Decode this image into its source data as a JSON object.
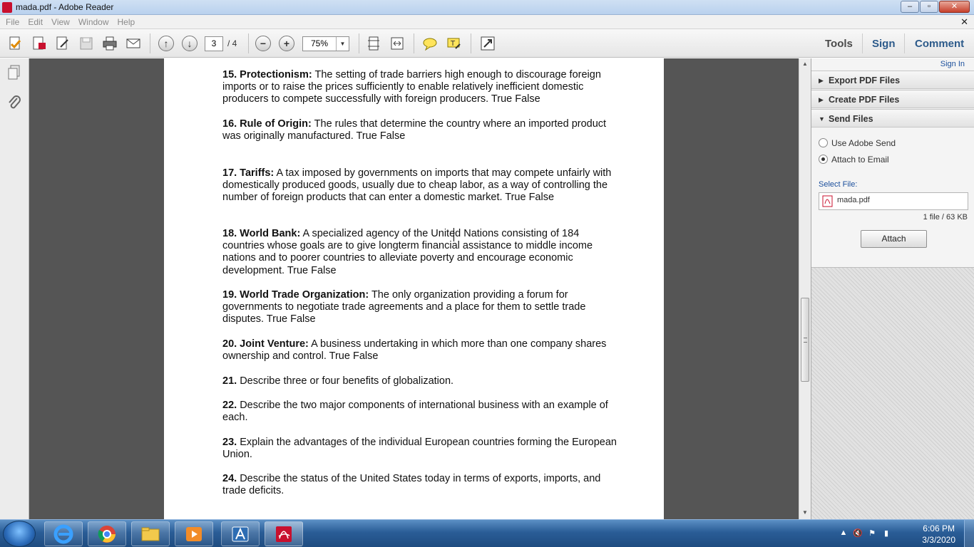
{
  "window": {
    "title": "mada.pdf - Adobe Reader",
    "buttons": {
      "minimize": "–",
      "maximize": "▫",
      "close": "✕"
    }
  },
  "menu": {
    "items": [
      "File",
      "Edit",
      "View",
      "Window",
      "Help"
    ],
    "close_glyph": "✕"
  },
  "toolbar": {
    "page_current": "3",
    "page_total": "/ 4",
    "zoom": "75%",
    "links": {
      "tools": "Tools",
      "sign": "Sign",
      "comment": "Comment"
    }
  },
  "document": {
    "questions": [
      {
        "num": "15. Protectionism:",
        "text": "  The setting of trade barriers high enough to discourage foreign imports or to raise the prices sufficiently to enable relatively inefficient domestic producers to compete successfully with foreign producers.  True  False"
      },
      {
        "num": "16. Rule of Origin:",
        "text": "  The rules that determine the country where an imported product was originally manufactured.  True  False"
      },
      {
        "num": "17. Tariffs:",
        "text": "  A tax imposed by governments on imports that may compete unfairly with domestically produced goods, usually due to cheap labor, as a way of controlling the number of foreign products that can enter a domestic market.  True  False"
      },
      {
        "num": "18. World Bank:",
        "text": "  A specialized agency of the United Nations consisting of 184 countries whose goals are to give longterm financial assistance to middle income nations and to poorer countries to alleviate poverty and encourage economic development.  True  False"
      },
      {
        "num": "19. World Trade Organization:",
        "text": "  The only organization providing a forum for governments to negotiate trade agreements and a place for them to settle trade disputes.  True  False"
      },
      {
        "num": "20. Joint Venture:",
        "text": "  A business undertaking in which more than one company shares ownership and control.  True  False"
      },
      {
        "num": "21.",
        "text": " Describe three or four benefits of globalization."
      },
      {
        "num": "22.",
        "text": " Describe the two major components of international business with an example of each."
      },
      {
        "num": "23.",
        "text": " Explain the advantages of the individual European countries forming the European Union."
      },
      {
        "num": "24.",
        "text": " Describe the status of the United States today in terms of exports, imports, and trade deficits."
      }
    ]
  },
  "rightpane": {
    "signin": "Sign In",
    "panels": [
      "Export PDF Files",
      "Create PDF Files",
      "Send Files"
    ],
    "send_options": [
      "Use Adobe Send",
      "Attach to Email"
    ],
    "selected_option": "Attach to Email",
    "select_file_label": "Select File:",
    "file_name": "mada.pdf",
    "file_info": "1 file / 63 KB",
    "attach_button": "Attach"
  },
  "taskbar": {
    "time": "6:06 PM",
    "date": "3/3/2020"
  },
  "colors": {
    "accent_blue": "#2c5a8a",
    "pdf_red": "#c8102e",
    "doc_bg": "#555555",
    "taskbar": "#2a5d97"
  }
}
